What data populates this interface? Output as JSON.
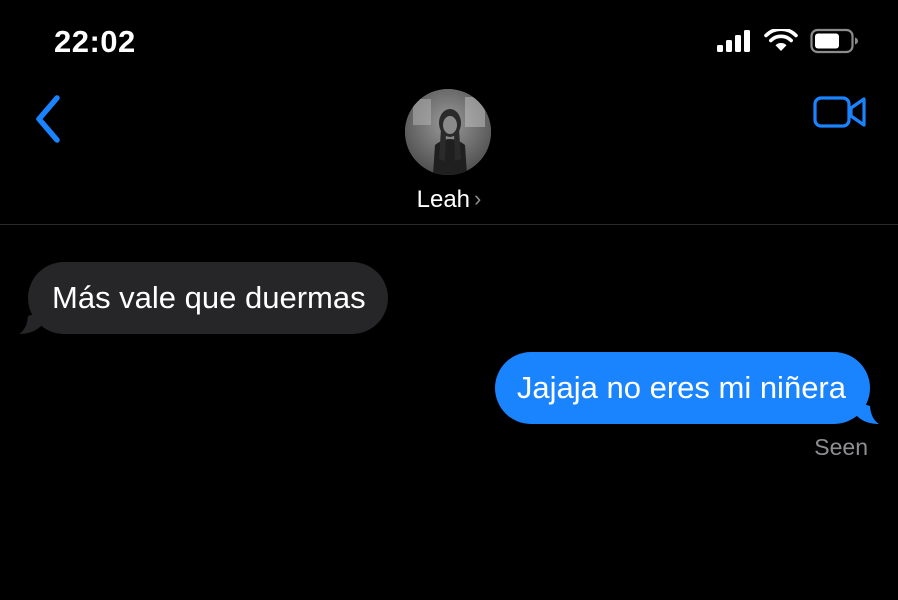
{
  "status_bar": {
    "time": "22:02",
    "icons": [
      "cellular-signal-icon",
      "wifi-icon",
      "battery-icon"
    ]
  },
  "header": {
    "back_icon": "chevron-left-icon",
    "contact_name": "Leah",
    "name_chevron": "›",
    "video_icon": "video-camera-icon",
    "accent_color": "#1a84ff"
  },
  "messages": [
    {
      "direction": "incoming",
      "text": "Más vale que duermas",
      "bubble_color": "#262628"
    },
    {
      "direction": "outgoing",
      "text": "Jajaja no eres mi niñera",
      "bubble_color": "#1a84ff"
    }
  ],
  "receipt": "Seen"
}
